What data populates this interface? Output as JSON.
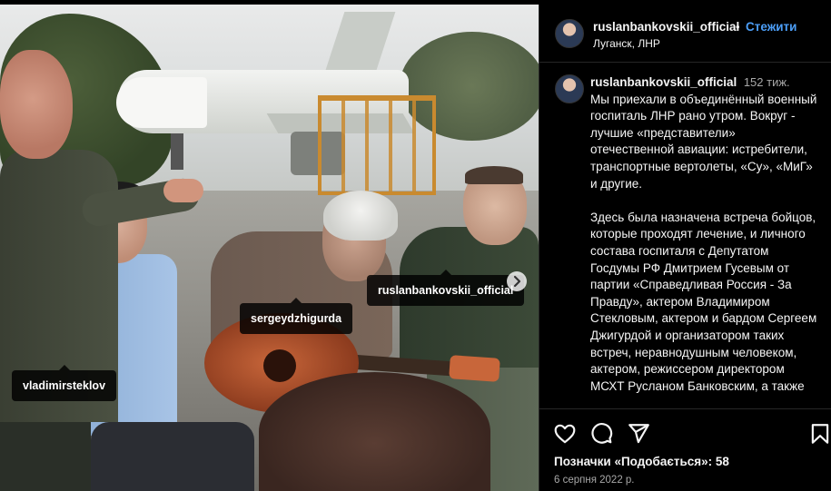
{
  "photo": {
    "tags": {
      "vladimir": "vladimirsteklov",
      "sergey": "sergeydzhigurda",
      "ruslan": "ruslanbankovskii_official"
    },
    "next_icon": "chevron-right-icon"
  },
  "header": {
    "username": "ruslanbankovskii_official",
    "dot": "•",
    "follow_label": "Стежити",
    "location": "Луганск, ЛНР"
  },
  "caption": {
    "username": "ruslanbankovskii_official",
    "time": "152 тиж.",
    "paragraph1": "Мы приехали в объединённый военный госпиталь ЛНР рано утром. Вокруг - лучшие «представители» отечественной авиации: истребители, транспортные вертолеты, «Су», «МиГ» и другие.",
    "paragraph2": "Здесь была назначена встреча бойцов, которые проходят лечение, и личного состава госпиталя с Депутатом Госдумы РФ Дмитрием Гусевым от партии «Справедливая Россия - За Правду», актером Владимиром Стекловым, актером и бардом Сергеем Джигурдой и организатором таких встреч, неравнодушным человеком, актером, режиссером директором МСХТ Русланом Банковским, а также"
  },
  "actions": {
    "like_icon": "heart-icon",
    "comment_icon": "comment-bubble-icon",
    "share_icon": "paper-plane-icon",
    "save_icon": "bookmark-icon",
    "likes_text": "Позначки «Подобається»: 58",
    "date": "6 серпня 2022 р."
  },
  "colors": {
    "background": "#000000",
    "text": "#f5f5f5",
    "secondary_text": "#a8a8a8",
    "follow_blue": "#4c9ef7",
    "divider": "#262626"
  }
}
